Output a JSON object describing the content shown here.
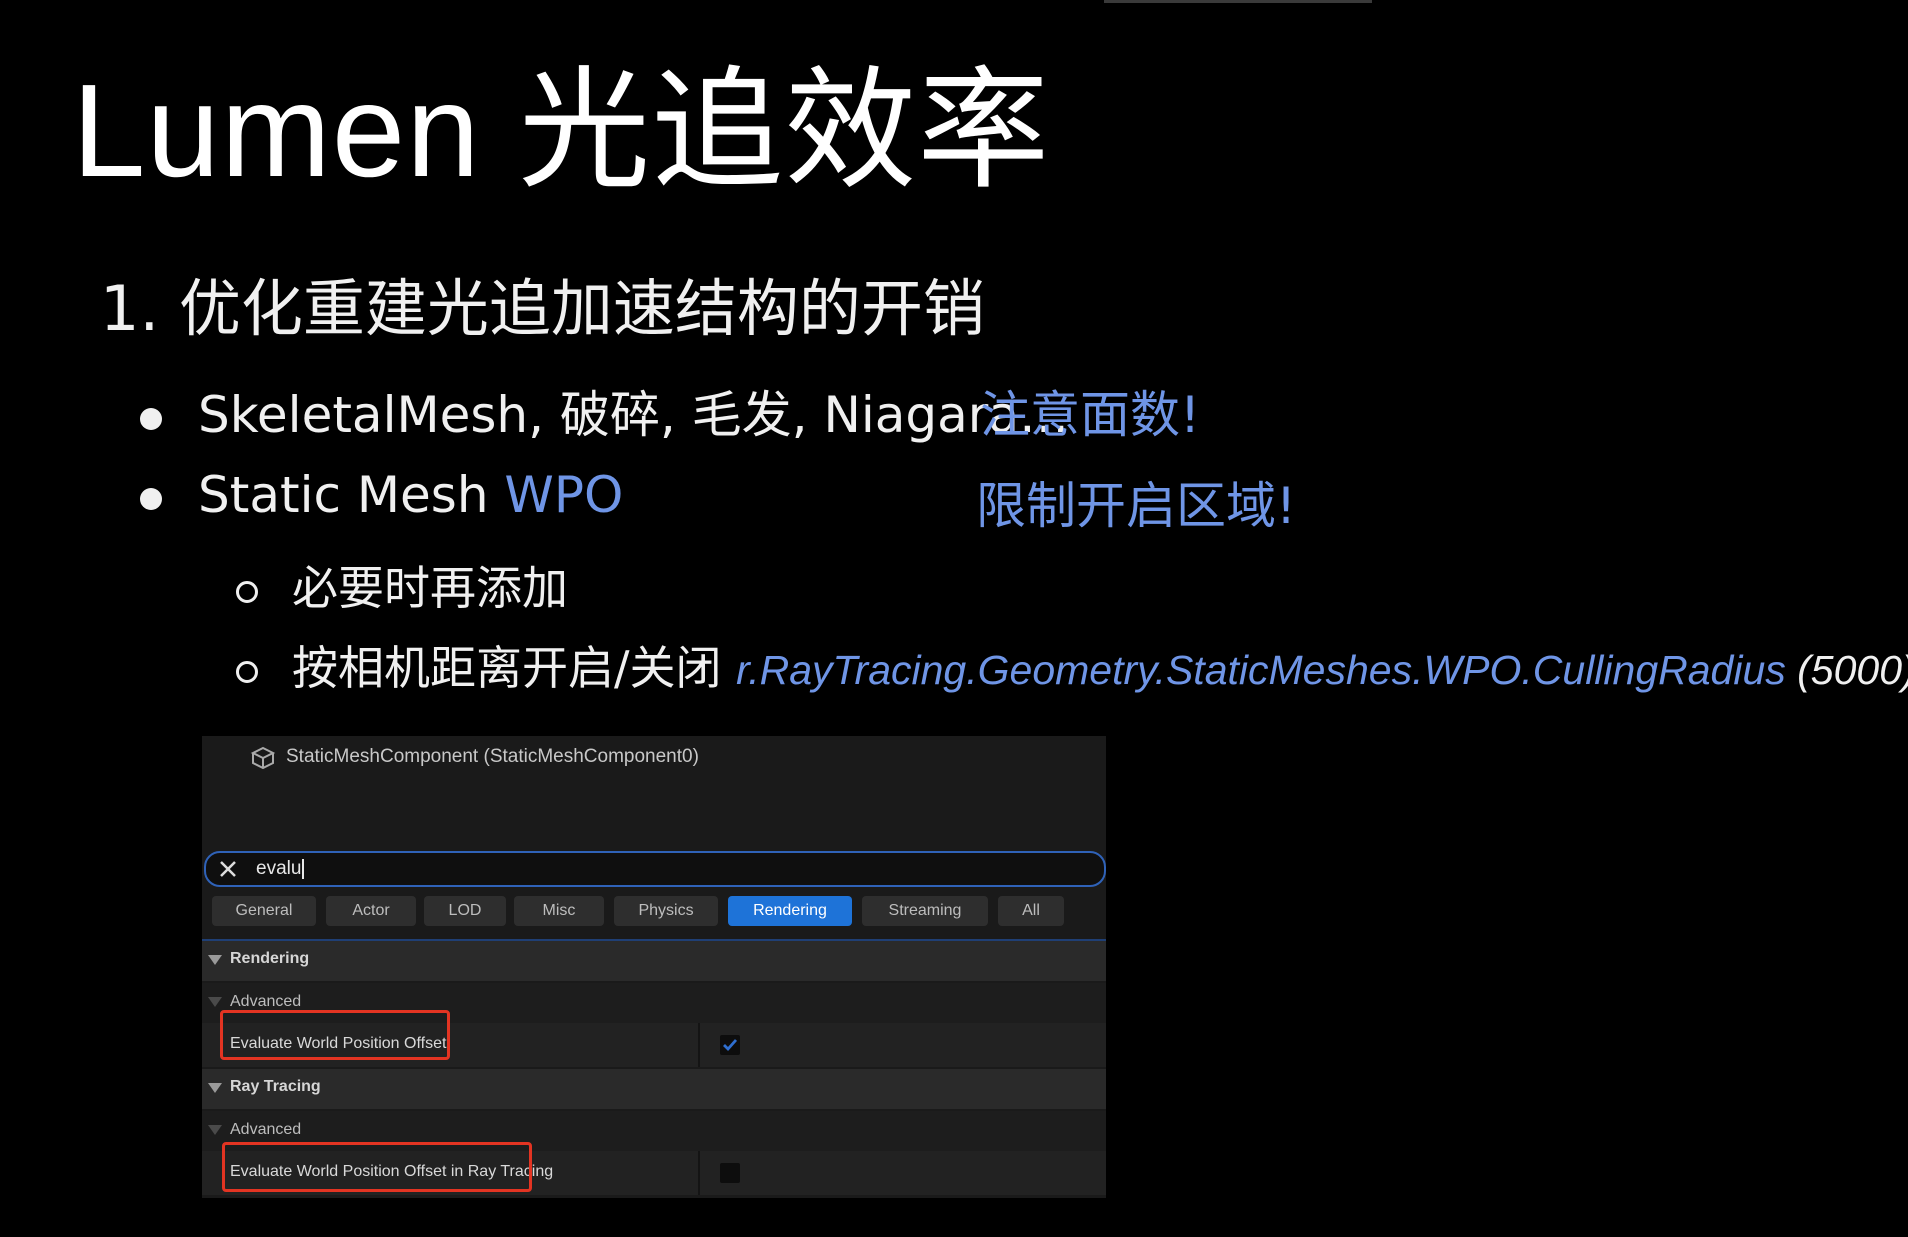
{
  "title": {
    "latin": "Lumen ",
    "cjk": "光追效率"
  },
  "heading": "1. 优化重建光追加速结构的开销",
  "bullets": [
    {
      "text": "SkeletalMesh, 破碎, 毛发, Niagara…",
      "note": "注意面数!"
    },
    {
      "text": "Static Mesh ",
      "highlight": "WPO",
      "note": "限制开启区域!"
    }
  ],
  "subbullets": [
    {
      "text": "必要时再添加"
    },
    {
      "text": "按相机距离开启/关闭 ",
      "cvar": "r.RayTracing.Geometry.StaticMeshes.WPO.CullingRadius",
      "value": " (5000)"
    }
  ],
  "panel": {
    "component": "StaticMeshComponent (StaticMeshComponent0)",
    "search_value": "evalu",
    "tabs": [
      "General",
      "Actor",
      "LOD",
      "Misc",
      "Physics",
      "Rendering",
      "Streaming",
      "All"
    ],
    "active_tab": "Rendering",
    "sections": [
      {
        "label": "Rendering",
        "sub": "Advanced",
        "property": "Evaluate World Position Offset",
        "checked": true
      },
      {
        "label": "Ray Tracing",
        "sub": "Advanced",
        "property": "Evaluate World Position Offset in Ray Tracing",
        "checked": false
      }
    ]
  },
  "colors": {
    "accent_blue": "#6f95e6",
    "tab_active": "#1e73d8",
    "highlight_box": "#e33422"
  },
  "icons": {
    "component": "component-cubes-icon",
    "clear": "close-icon",
    "expand": "chevron-down-icon",
    "check": "checkmark-icon"
  }
}
